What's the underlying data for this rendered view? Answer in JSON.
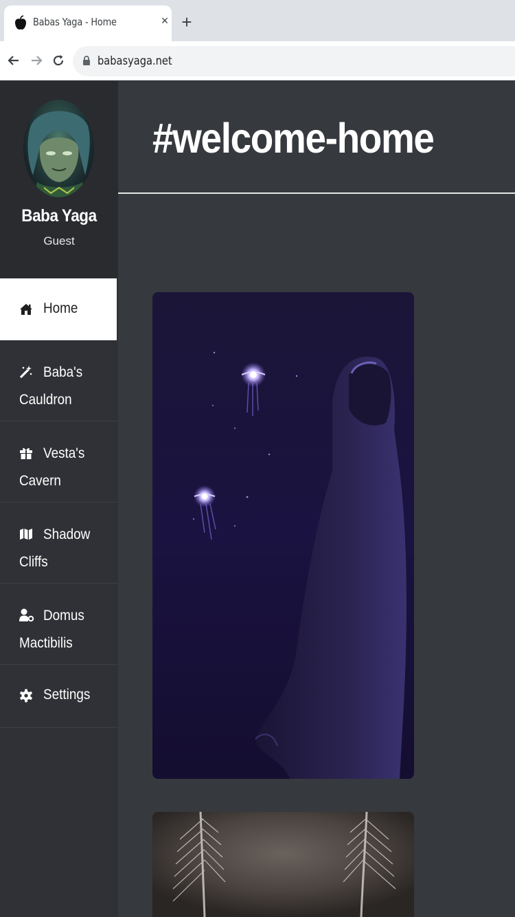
{
  "browser": {
    "tab_title": "Babas Yaga - Home",
    "close_glyph": "×",
    "new_tab_glyph": "+",
    "url": "babasyaga.net"
  },
  "profile": {
    "name": "Baba Yaga",
    "role": "Guest"
  },
  "nav": {
    "items": [
      {
        "icon": "home-icon",
        "line1": "Home",
        "line2": "",
        "active": true
      },
      {
        "icon": "magic-wand-icon",
        "line1": "Baba's",
        "line2": "Cauldron",
        "active": false
      },
      {
        "icon": "gift-icon",
        "line1": "Vesta's",
        "line2": "Cavern",
        "active": false
      },
      {
        "icon": "map-icon",
        "line1": "Shadow",
        "line2": "Cliffs",
        "active": false
      },
      {
        "icon": "user-key-icon",
        "line1": "Domus",
        "line2": "Mactibilis",
        "active": false
      },
      {
        "icon": "gear-icon",
        "line1": "Settings",
        "line2": "",
        "active": false
      }
    ]
  },
  "main": {
    "title": "#welcome-home"
  },
  "colors": {
    "sidebar_bg": "#2f3136",
    "profile_bg": "#292b2f",
    "main_bg": "#36393e",
    "active_item_bg": "#ffffff",
    "text": "#ffffff"
  }
}
